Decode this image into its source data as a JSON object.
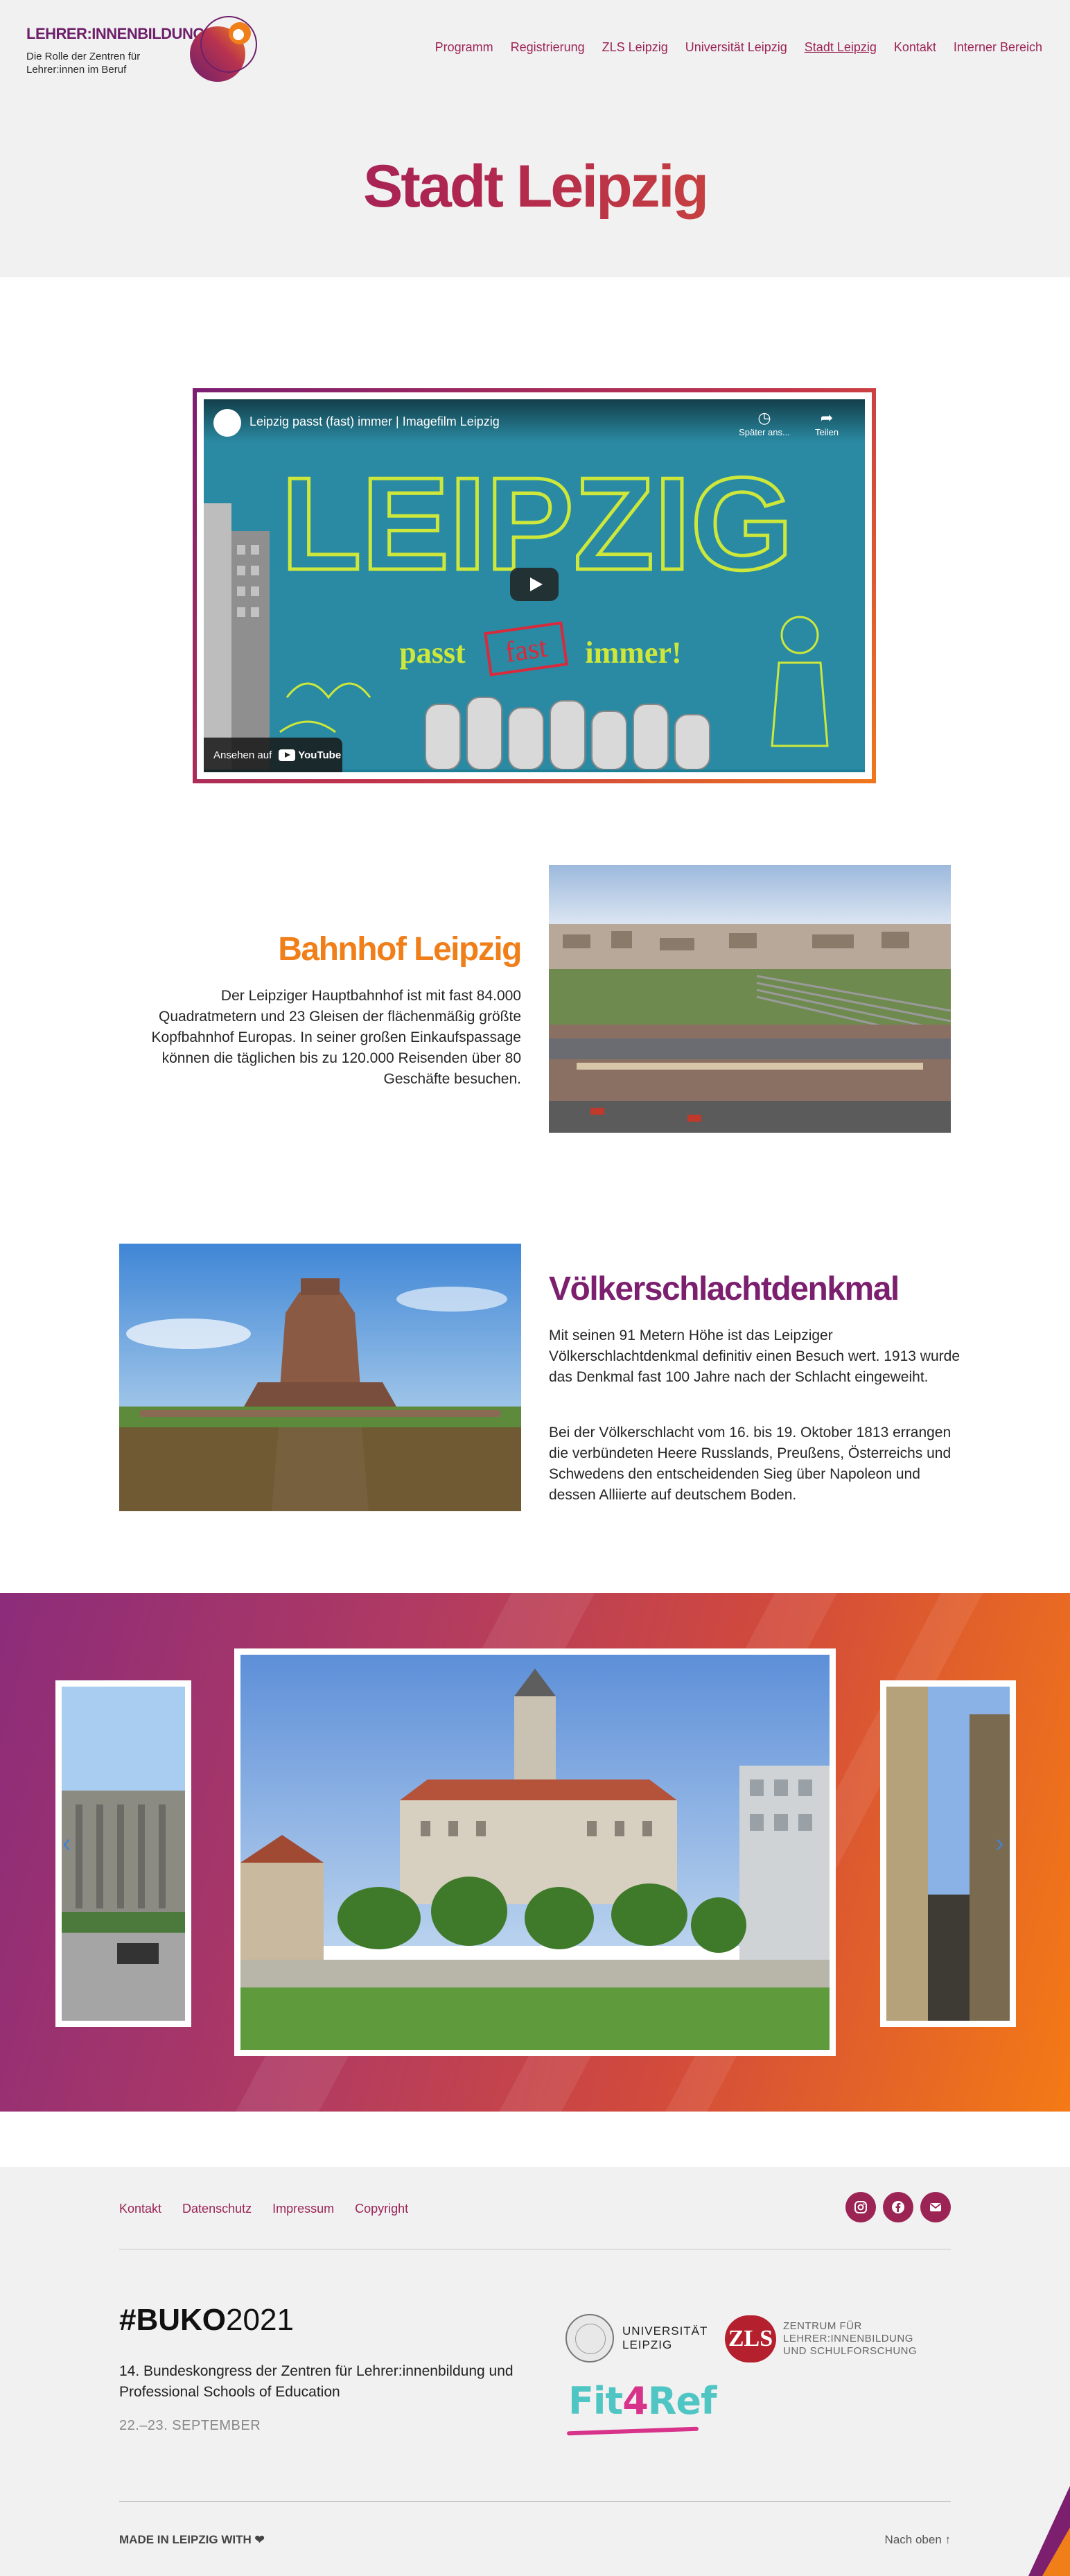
{
  "header": {
    "logo_title": "LEHRER:INNENBILDUNG",
    "logo_subtitle": "Die Rolle der Zentren für Lehrer:innen im Beruf",
    "nav": [
      {
        "label": "Programm"
      },
      {
        "label": "Registrierung"
      },
      {
        "label": "ZLS Leipzig"
      },
      {
        "label": "Universität Leipzig"
      },
      {
        "label": "Stadt Leipzig",
        "active": true
      },
      {
        "label": "Kontakt"
      },
      {
        "label": "Interner Bereich"
      }
    ],
    "page_title": "Stadt Leipzig"
  },
  "video": {
    "title": "Leipzig passt (fast) immer | Imagefilm Leipzig",
    "later_label": "Später ans...",
    "share_label": "Teilen",
    "watch_on": "Ansehen auf",
    "youtube": "YouTube",
    "thumb_main": "LEIPZIG",
    "thumb_sub1": "passt",
    "thumb_sub2": "fast",
    "thumb_sub3": "immer!"
  },
  "bahnhof": {
    "heading": "Bahnhof Leipzig",
    "text": "Der Leipziger Hauptbahnhof ist mit fast 84.000 Quadratmetern und 23 Gleisen der flächenmäßig größte Kopfbahnhof Europas. In seiner großen Einkaufspassage können die täglichen bis zu 120.000 Reisenden über 80 Geschäfte besuchen.",
    "color": "#f07f1a"
  },
  "denkmal": {
    "heading": "Völkerschlachtdenkmal",
    "text1": "Mit seinen 91 Metern Höhe ist das Leipziger Völkerschlachtdenkmal definitiv einen Besuch wert. 1913 wurde das Denkmal fast 100 Jahre nach der Schlacht eingeweiht.",
    "text2": "Bei der Völkerschlacht vom 16. bis 19. Oktober 1813 errangen die verbündeten Heere Russlands, Preußens, Österreichs und Schwedens den entscheidenden Sieg über Napoleon und dessen Alliierte auf deutschem Boden.",
    "color": "#7b1f6e"
  },
  "gallery": {
    "prev_icon": "chevron-left-icon",
    "next_icon": "chevron-right-icon"
  },
  "footer": {
    "links": [
      {
        "label": "Kontakt"
      },
      {
        "label": "Datenschutz"
      },
      {
        "label": "Impressum"
      },
      {
        "label": "Copyright"
      }
    ],
    "social": [
      {
        "icon": "instagram-icon"
      },
      {
        "icon": "facebook-icon"
      },
      {
        "icon": "mail-icon"
      }
    ],
    "buko_bold": "#BUKO",
    "buko_year": "2021",
    "description": "14. Bundeskongress der Zentren für Lehrer:innenbildung und Professional Schools of Education",
    "date": "22.–23. SEPTEMBER",
    "uni_name_1": "UNIVERSITÄT",
    "uni_name_2": "LEIPZIG",
    "zls_badge": "ZLS",
    "zls_text_1": "ZENTRUM FÜR",
    "zls_text_2": "LEHRER:INNENBILDUNG",
    "zls_text_3": "UND SCHULFORSCHUNG",
    "fit_a": "Fit",
    "fit_b": "4",
    "fit_c": "Ref",
    "made_in": "MADE IN LEIPZIG WITH ❤",
    "to_top": "Nach oben ↑"
  }
}
